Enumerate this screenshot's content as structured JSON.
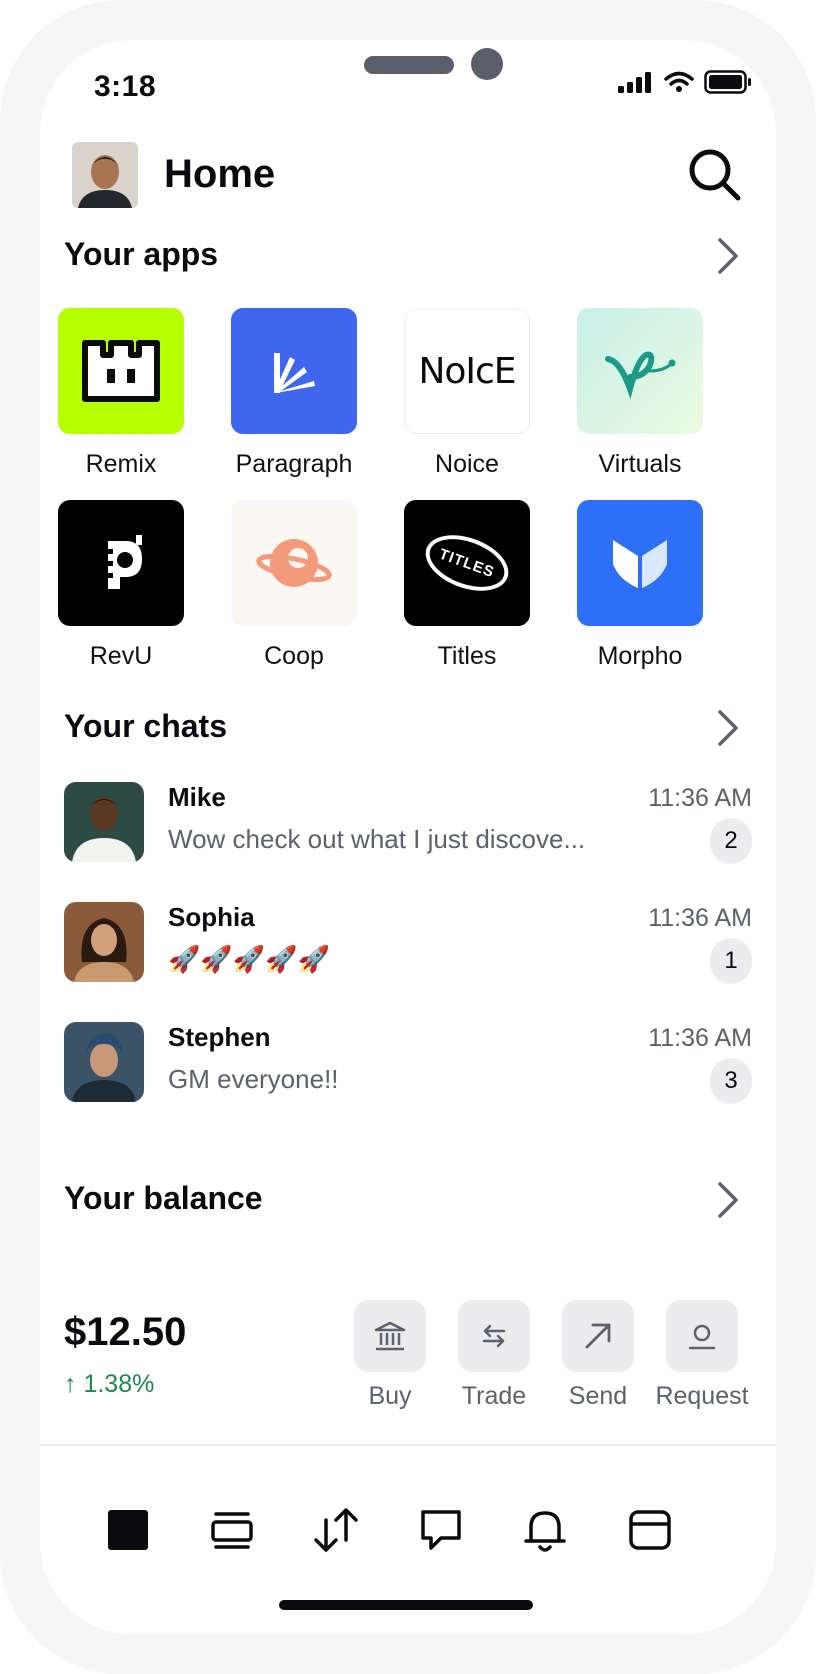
{
  "status_bar": {
    "time": "3:18"
  },
  "header": {
    "title": "Home"
  },
  "apps": {
    "title": "Your apps",
    "items": [
      {
        "label": "Remix",
        "icon": "remix-icon",
        "bg": "#b6ff00"
      },
      {
        "label": "Paragraph",
        "icon": "paragraph-icon",
        "bg": "#3f66ee"
      },
      {
        "label": "Noice",
        "icon": "noice-icon",
        "bg": "#ffffff",
        "logo_text": "NoIcE"
      },
      {
        "label": "Virtuals",
        "icon": "virtuals-icon",
        "bg": "#d6f4ea"
      },
      {
        "label": "RevU",
        "icon": "revu-icon",
        "bg": "#000000"
      },
      {
        "label": "Coop",
        "icon": "coop-icon",
        "bg": "#fbf8f3"
      },
      {
        "label": "Titles",
        "icon": "titles-icon",
        "bg": "#000000",
        "logo_text": "TITLES"
      },
      {
        "label": "Morpho",
        "icon": "morpho-icon",
        "bg": "#2d6ff7"
      }
    ]
  },
  "chats": {
    "title": "Your chats",
    "items": [
      {
        "name": "Mike",
        "message": "Wow check out what I just discove...",
        "time": "11:36 AM",
        "badge": "2"
      },
      {
        "name": "Sophia",
        "message": "🚀🚀🚀🚀🚀",
        "time": "11:36 AM",
        "badge": "1"
      },
      {
        "name": "Stephen",
        "message": "GM everyone!!",
        "time": "11:36 AM",
        "badge": "3"
      }
    ]
  },
  "balance": {
    "title": "Your balance",
    "amount": "$12.50",
    "change": "↑ 1.38%",
    "actions": [
      {
        "label": "Buy",
        "icon": "bank-icon"
      },
      {
        "label": "Trade",
        "icon": "swap-icon"
      },
      {
        "label": "Send",
        "icon": "arrow-up-right-icon"
      },
      {
        "label": "Request",
        "icon": "user-request-icon"
      }
    ]
  },
  "nav": [
    "home-icon",
    "feed-icon",
    "transfer-icon",
    "chat-icon",
    "bell-icon",
    "wallet-icon"
  ],
  "colors": {
    "accent_green": "#1b8a4c",
    "muted_text": "#5d616c",
    "chip_bg": "#ececee"
  }
}
